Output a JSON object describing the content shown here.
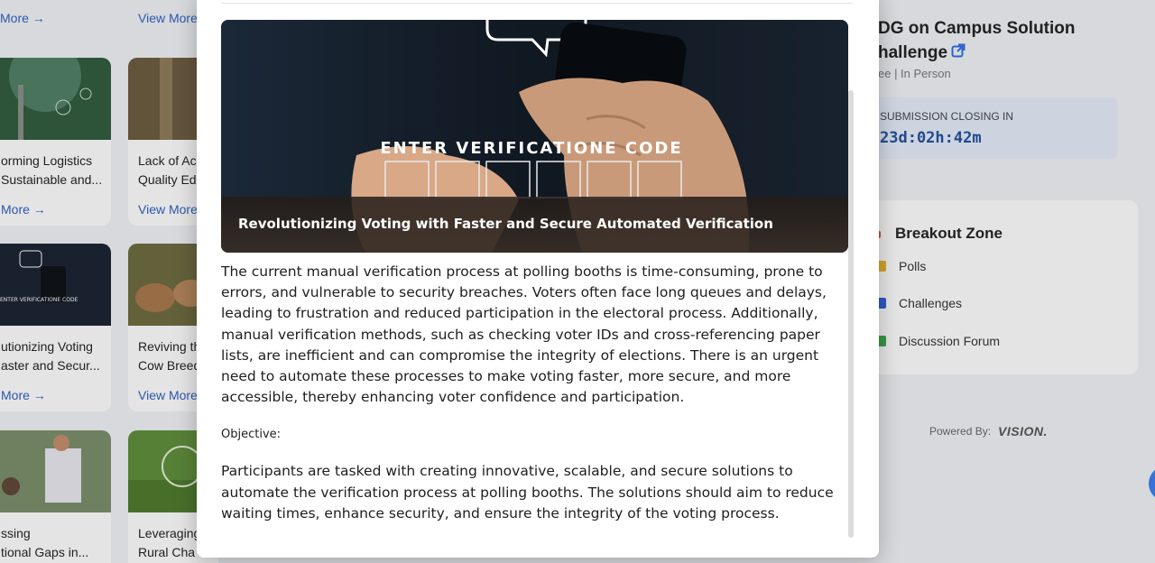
{
  "background": {
    "top_row_links": [
      "More →",
      "View More →"
    ],
    "cards": [
      {
        "title_line1": "orming Logistics",
        "title_line2": "Sustainable and...",
        "link": "More →"
      },
      {
        "title_line1": "Lack of Ac",
        "title_line2": "Quality Ed",
        "link": "View More →"
      },
      {
        "title_line1": "utionizing Voting",
        "title_line2": "aster and Secur...",
        "link": "More →"
      },
      {
        "title_line1": "Reviving th",
        "title_line2": "Cow Breed",
        "link": "View More →"
      },
      {
        "title_line1": "ssing",
        "title_line2": "tional Gaps in...",
        "link": ""
      },
      {
        "title_line1": "Leveraging",
        "title_line2": "Rural Cha",
        "link": ""
      }
    ],
    "right_panel": {
      "title_line1": "DG on Campus Solution",
      "title_line2": "hallenge",
      "meta": "ee | In Person",
      "closing_label": "SUBMISSION CLOSING IN",
      "closing_time": "23d:02h:42m",
      "breakout_title": "Breakout Zone",
      "breakout_items": [
        "Polls",
        "Challenges",
        "Discussion Forum"
      ],
      "powered_by": "Powered By:",
      "powered_logo": "VISION."
    }
  },
  "modal": {
    "hero_overlay_text": "ENTER VERIFICATIONE CODE",
    "hero_caption": "Revolutionizing Voting with Faster and Secure Automated Verification",
    "description": "The current manual verification process at polling booths is time-consuming, prone to errors, and vulnerable to security breaches. Voters often face long queues and delays, leading to frustration and reduced participation in the electoral process. Additionally, manual verification methods, such as checking voter IDs and cross-referencing paper lists, are inefficient and can compromise the integrity of elections. There is an urgent need to automate these processes to make voting faster, more secure, and more accessible, thereby enhancing voter confidence and participation.",
    "objective_label": "Objective:",
    "objective_text": "Participants are tasked with creating innovative, scalable, and secure solutions to automate the verification process at polling booths. The solutions should aim to reduce waiting times, enhance security, and ensure the integrity of the voting process."
  },
  "colors": {
    "link": "#2f5fc2",
    "closing_bg": "#e5edfb",
    "closing_time": "#1f4f9e",
    "fab": "#3b7ef0"
  }
}
